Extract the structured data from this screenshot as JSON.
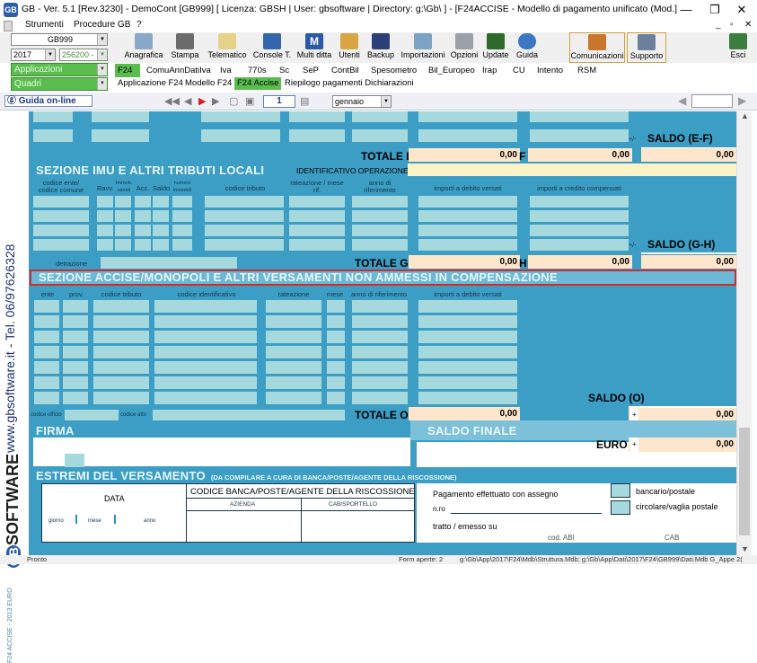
{
  "window": {
    "title": "GB - Ver. 5.1 [Rev.3230] - DemoCont [GB999]    [ Licenza: GBSH | User: gbsoftware | Directory: g:\\Gb\\ ] - [F24ACCISE - Modello di pagamento unificato (Mod.]",
    "logo": "GB",
    "min": "—",
    "max": "❐",
    "close": "✕"
  },
  "menu": {
    "items": [
      "Strumenti",
      "Procedure GB",
      "?"
    ],
    "inner_controls": [
      "_",
      "▫",
      "✕"
    ]
  },
  "left_selectors": {
    "company": "GB999",
    "year": "2017",
    "code": "256200 -",
    "applicazioni": "Applicazioni",
    "quadri": "Quadri"
  },
  "toolbar": {
    "buttons": [
      "Anagrafica",
      "Stampa",
      "Telematico",
      "Console T.",
      "Multi ditta",
      "Utenti",
      "Backup",
      "Importazioni",
      "Opzioni",
      "Update",
      "Guida",
      "Comunicazioni",
      "Supporto",
      "Esci"
    ],
    "multi_ditta_letter": "M"
  },
  "tabs1": [
    "F24",
    "ComuAnnDatiIva",
    "Iva",
    "770s",
    "Sc",
    "SeP",
    "ContBil",
    "Spesometro",
    "Bil_Europeo",
    "Irap",
    "CU",
    "Intento",
    "RSM"
  ],
  "tabs2": [
    "Applicazione F24",
    "Modello F24",
    "F24 Accise",
    "Riepilogo pagamenti Dichiarazioni"
  ],
  "nav": {
    "guida": "Guida on-line",
    "page": "1",
    "month": "gennaio"
  },
  "side": {
    "phone": "www.gbsoftware.it - Tel. 06/97626328",
    "brand_gb": "GB",
    "brand_soft": "SOFTWARE",
    "footer": "F24 ACCISE - 2013 EURO"
  },
  "form": {
    "totale_e": "TOTALE E",
    "val_e": "0,00",
    "letter_f": "F",
    "val_f": "0,00",
    "saldo_ef": "SALDO  (E-F)",
    "saldo_ef_val": "0,00",
    "pm": "+/-",
    "imu_title": "SEZIONE IMU E ALTRI TRIBUTI LOCALI",
    "identificativo": "IDENTIFICATIVO OPERAZIONE",
    "imu_cols": {
      "codice_ente": "codice ente/ codice comune",
      "ravv": "Ravv.",
      "immob": "Immob. variati",
      "acc": "Acc.",
      "saldo": "Saldo",
      "numero": "numero immobili",
      "codice_tributo": "codice tributo",
      "rateazione": "rateazione / mese rif.",
      "anno": "anno di riferimento",
      "debito": "importi a debito versati",
      "credito": "importi a credito compensati"
    },
    "detrazione": "detrazione",
    "totale_g": "TOTALE G",
    "val_g": "0,00",
    "letter_h": "H",
    "val_h": "0,00",
    "saldo_gh": "SALDO  (G-H)",
    "saldo_gh_val": "0,00",
    "accise_title": "SEZIONE ACCISE/MONOPOLI E ALTRI VERSAMENTI NON AMMESSI IN COMPENSAZIONE",
    "accise_cols": {
      "ente": "ente",
      "prov": "prov.",
      "codice_tributo": "codice tributo",
      "codice_id": "codice identificativo",
      "rateazione": "rateazione",
      "mese": "mese",
      "anno": "anno di riferimento",
      "debito": "importi a debito versati"
    },
    "codice_ufficio": "codice ufficio",
    "codice_atto": "codice atto",
    "totale_o": "TOTALE O",
    "val_o": "0,00",
    "saldo_o": "SALDO  (O)",
    "saldo_o_val": "0,00",
    "plus": "+",
    "firma": "FIRMA",
    "saldo_finale": "SALDO FINALE",
    "euro": "EURO",
    "euro_val": "0,00",
    "estremi": "ESTREMI DEL VERSAMENTO",
    "estremi_note": "(DA COMPILARE A CURA DI BANCA/POSTE/AGENTE DELLA RISCOSSIONE)",
    "data": "DATA",
    "giorno": "giorno",
    "mese": "mese",
    "anno_l": "anno",
    "codice_banca": "CODICE BANCA/POSTE/AGENTE DELLA RISCOSSIONE",
    "azienda": "AZIENDA",
    "cab_sportello": "CAB/SPORTELLO",
    "pagamento": "Pagamento effettuato con assegno",
    "nro": "n.ro",
    "tratto": "tratto / emesso su",
    "bancario": "bancario/postale",
    "circolare": "circolare/vaglia postale",
    "cod_abi": "cod. ABI",
    "cab": "CAB"
  },
  "status": {
    "left": "Pronto",
    "form": "Form aperte: 2",
    "path": "g:\\Gb\\App\\2017\\F24\\Mdb\\Struttura.Mdb; g:\\Gb\\App\\Dati\\2017\\F24\\GB999\\Dati.Mdb G_Appe 2("
  }
}
